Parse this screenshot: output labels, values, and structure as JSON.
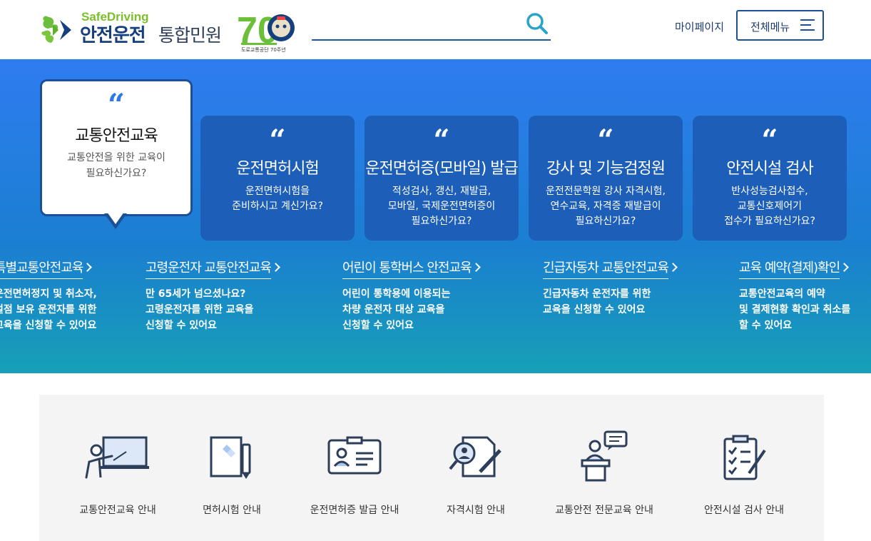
{
  "header": {
    "logo_en": "SafeDriving",
    "logo_ko_main": "안전운전",
    "logo_ko_sub": "통합민원",
    "anniversary_number": "70",
    "anniversary_caption": "도로교통공단 70주년",
    "search": {
      "value": "",
      "placeholder": ""
    },
    "mypage_label": "마이페이지",
    "menu_label": "전체메뉴"
  },
  "hero": {
    "featured": {
      "title": "교통안전교육",
      "desc_1": "교통안전을 위한 교육이",
      "desc_2": "필요하신가요?"
    },
    "cards": [
      {
        "title": "운전면허시험",
        "desc_1": "운전면허시험을",
        "desc_2": "준비하시고 계신가요?",
        "desc_3": ""
      },
      {
        "title": "운전면허증(모바일) 발급",
        "desc_1": "적성검사, 갱신, 재발급,",
        "desc_2": "모바일, 국제운전면허증이",
        "desc_3": "필요하신가요?"
      },
      {
        "title": "강사 및 기능검정원",
        "desc_1": "운전전문학원 강사 자격시험,",
        "desc_2": "연수교육, 자격증 재발급이",
        "desc_3": "필요하신가요?"
      },
      {
        "title": "안전시설 검사",
        "desc_1": "반사성능검사접수,",
        "desc_2": "교통신호제어기",
        "desc_3": "접수가 필요하신가요?"
      }
    ],
    "links": [
      {
        "title": "특별교통안전교육",
        "desc_1": "운전면허정지 및 취소자,",
        "desc_2": "벌점 보유 운전자를 위한",
        "desc_3": "교육을 신청할 수 있어요"
      },
      {
        "title": "고령운전자 교통안전교육",
        "desc_1": "만 65세가 넘으셨나요?",
        "desc_2": "고령운전자를 위한 교육을",
        "desc_3": "신청할 수 있어요"
      },
      {
        "title": "어린이 통학버스 안전교육",
        "desc_1": "어린이 통학용에 이용되는",
        "desc_2": "차량 운전자 대상 교육을",
        "desc_3": "신청할 수 있어요"
      },
      {
        "title": "긴급자동차 교통안전교육",
        "desc_1": "긴급자동차 운전자를 위한",
        "desc_2": "교육을 신청할 수 있어요",
        "desc_3": ""
      },
      {
        "title": "교육 예약(결제)확인",
        "desc_1": "교통안전교육의 예약",
        "desc_2": "및 결제현황 확인과 취소를",
        "desc_3": "할 수 있어요"
      }
    ]
  },
  "quick_menu": [
    {
      "label": "교통안전교육 안내",
      "icon": "lecture-board-icon"
    },
    {
      "label": "면허시험 안내",
      "icon": "document-pen-icon"
    },
    {
      "label": "운전면허증 발급 안내",
      "icon": "id-card-icon"
    },
    {
      "label": "자격시험 안내",
      "icon": "exam-search-icon"
    },
    {
      "label": "교통안전 전문교육 안내",
      "icon": "podium-speaker-icon"
    },
    {
      "label": "안전시설 검사 안내",
      "icon": "checklist-icon"
    }
  ],
  "colors": {
    "brand_navy": "#163f7d",
    "brand_green": "#7cbf2c",
    "hero_top": "#2f7cf0",
    "hero_bottom": "#17a0b7",
    "card_blue": "#1c5eb8",
    "quote_blue": "#2f79e6"
  }
}
